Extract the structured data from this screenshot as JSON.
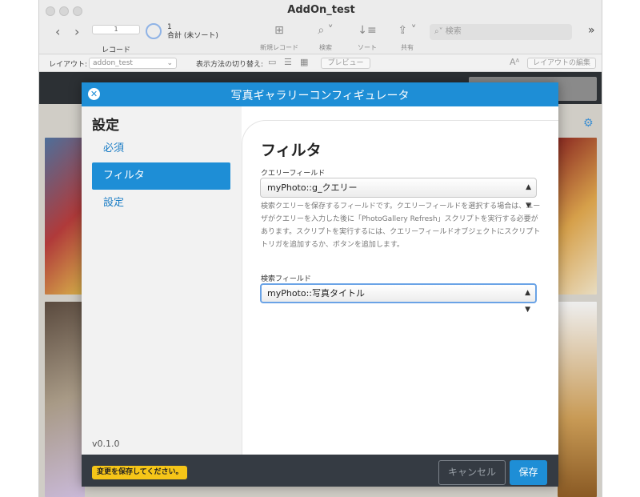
{
  "window": {
    "title": "AddOn_test"
  },
  "toolbar": {
    "record_value": "1",
    "record_label": "レコード",
    "count_value": "1",
    "count_text": "合計 (未ソート)",
    "new_record": "新規レコード",
    "search_label": "検索",
    "sort_label": "ソート",
    "share_label": "共有",
    "search_placeholder": "検索"
  },
  "layoutbar": {
    "layout_label": "レイアウト:",
    "layout_value": "addon_test",
    "view_switch_label": "表示方法の切り替え:",
    "preview": "プレビュー",
    "edit_layout": "レイアウトの編集"
  },
  "modal": {
    "title": "写真ギャラリーコンフィギュレータ",
    "sidebar_title": "設定",
    "sidebar_items": [
      "必須",
      "フィルタ",
      "設定"
    ],
    "version": "v0.1.0",
    "panel_title": "フィルタ",
    "query_field_label": "クエリーフィールド",
    "query_field_value": "myPhoto::g_クエリー",
    "help_text": "検索クエリーを保存するフィールドです。クエリーフィールドを選択する場合は、ユーザがクエリーを入力した後に「PhotoGallery Refresh」スクリプトを実行する必要があります。スクリプトを実行するには、クエリーフィールドオブジェクトにスクリプトトリガを追加するか、ボタンを追加します。",
    "search_field_label": "検索フィールド",
    "search_field_value": "myPhoto::写真タイトル",
    "save_warning": "変更を保存してください。",
    "cancel": "キャンセル",
    "save": "保存"
  },
  "colors": {
    "accent": "#1e8ed6",
    "warning": "#f5c518",
    "footer": "#353b43"
  }
}
